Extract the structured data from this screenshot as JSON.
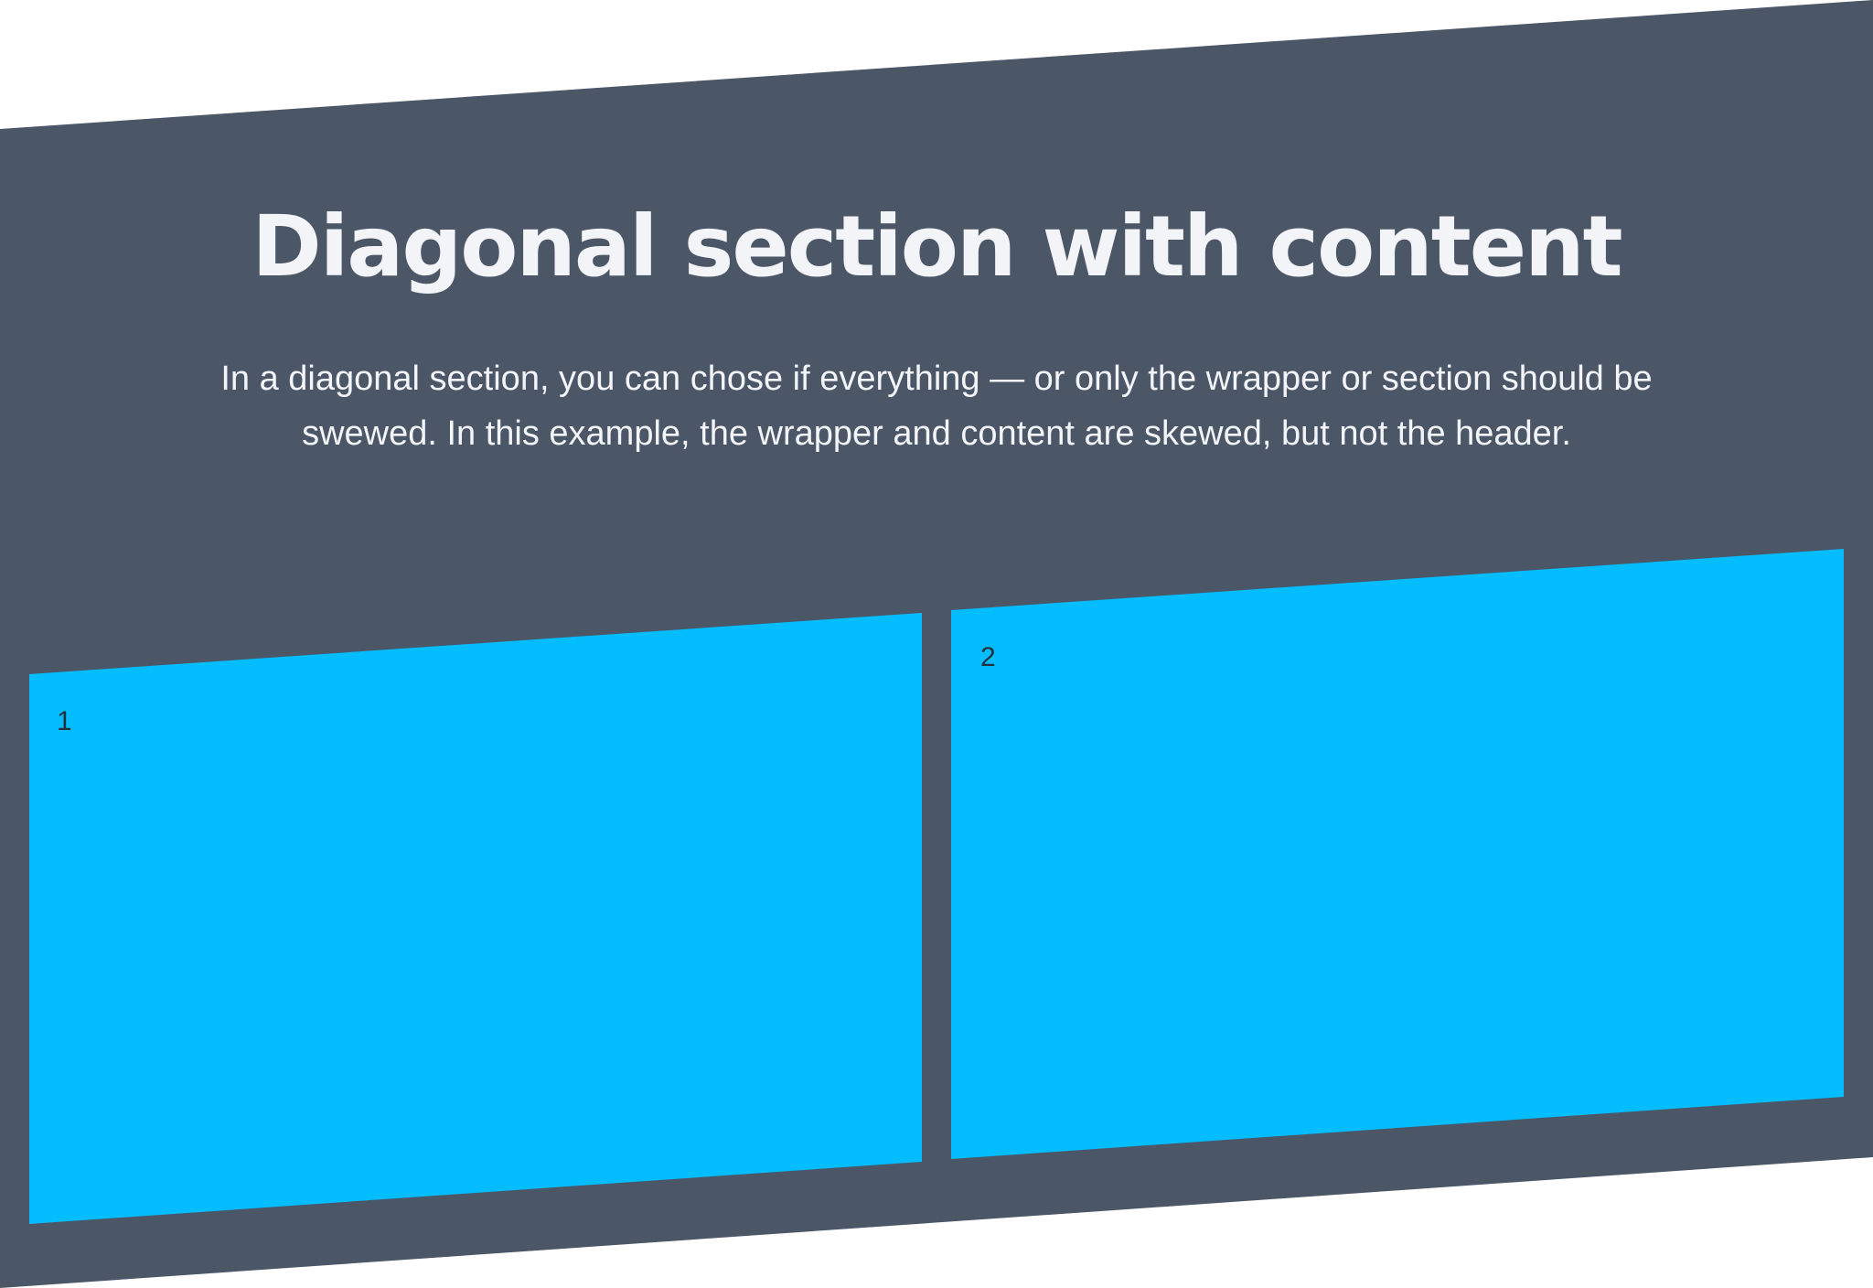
{
  "header": {
    "title": "Diagonal section with content",
    "description": "In a diagonal section, you can chose if everything — or only the wrapper or section should be swewed. In this example, the wrapper and content are skewed, but not the header."
  },
  "cards": [
    {
      "label": "1"
    },
    {
      "label": "2"
    }
  ],
  "colors": {
    "section_background": "#4b5667",
    "card_background": "#04bdfe",
    "page_background": "#ffffff",
    "text_light": "#f3f4f8",
    "text_dark": "#223040"
  }
}
